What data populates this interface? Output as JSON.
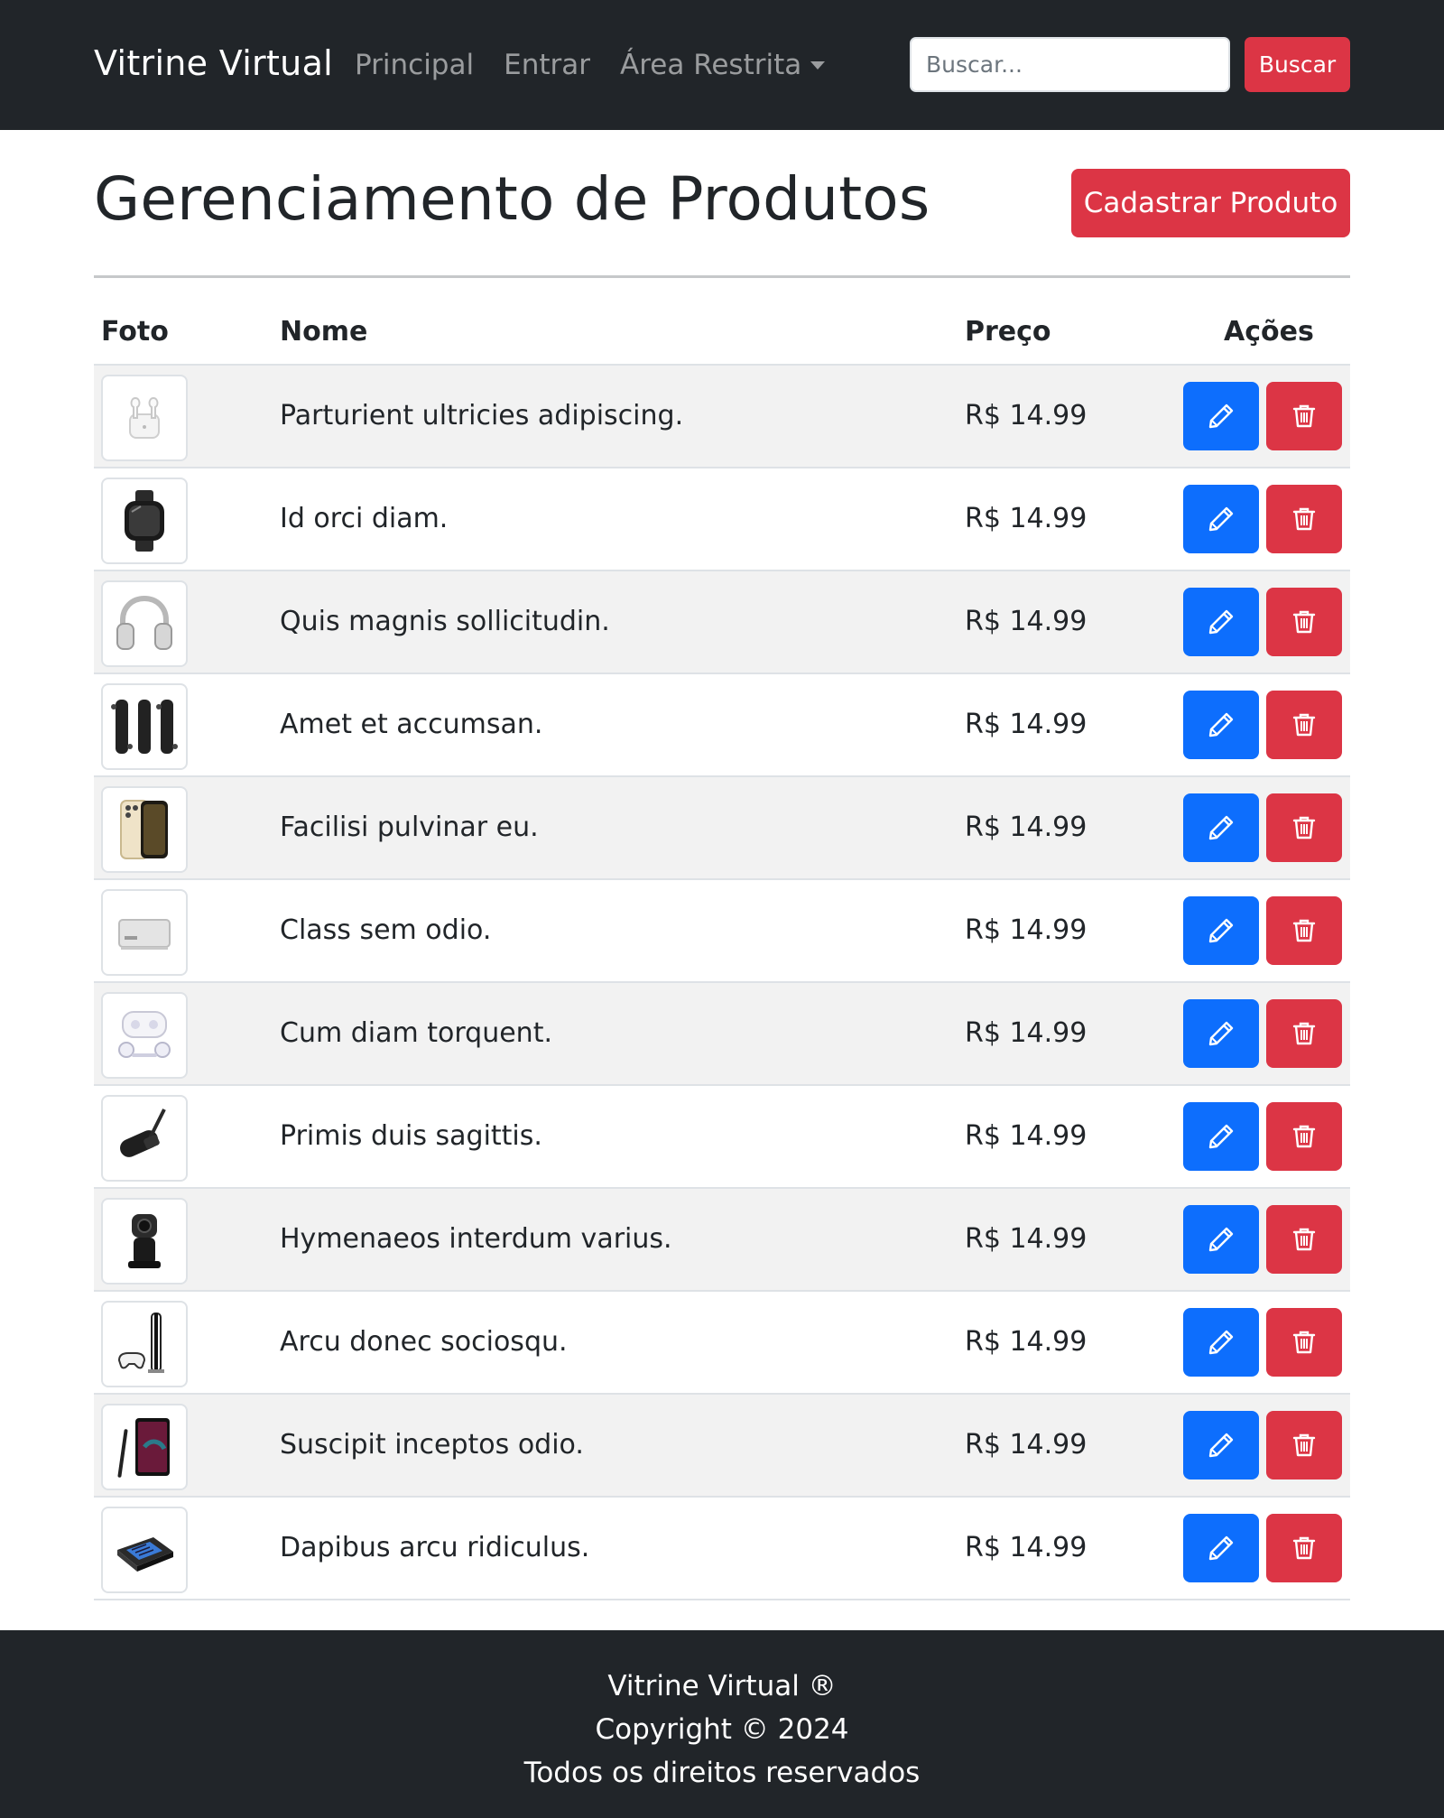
{
  "navbar": {
    "brand": "Vitrine Virtual",
    "links": [
      "Principal",
      "Entrar"
    ],
    "dropdown_label": "Área Restrita",
    "search_placeholder": "Buscar...",
    "search_button": "Buscar"
  },
  "page": {
    "title": "Gerenciamento de Produtos",
    "add_button": "Cadastrar Produto"
  },
  "table": {
    "headers": {
      "foto": "Foto",
      "nome": "Nome",
      "preco": "Preço",
      "acoes": "Ações"
    },
    "rows": [
      {
        "photo_icon": "earbuds-icon",
        "name": "Parturient ultricies adipiscing.",
        "price": "R$ 14.99"
      },
      {
        "photo_icon": "smartwatch-icon",
        "name": "Id orci diam.",
        "price": "R$ 14.99"
      },
      {
        "photo_icon": "headphones-icon",
        "name": "Quis magnis sollicitudin.",
        "price": "R$ 14.99"
      },
      {
        "photo_icon": "skateboard-icon",
        "name": "Amet et accumsan.",
        "price": "R$ 14.99"
      },
      {
        "photo_icon": "smartphone-icon",
        "name": "Facilisi pulvinar eu.",
        "price": "R$ 14.99"
      },
      {
        "photo_icon": "desktop-computer-icon",
        "name": "Class sem odio.",
        "price": "R$ 14.99"
      },
      {
        "photo_icon": "vr-headset-icon",
        "name": "Cum diam torquent.",
        "price": "R$ 14.99"
      },
      {
        "photo_icon": "microphone-icon",
        "name": "Primis duis sagittis.",
        "price": "R$ 14.99"
      },
      {
        "photo_icon": "webcam-icon",
        "name": "Hymenaeos interdum varius.",
        "price": "R$ 14.99"
      },
      {
        "photo_icon": "game-console-icon",
        "name": "Arcu donec sociosqu.",
        "price": "R$ 14.99"
      },
      {
        "photo_icon": "phone-stylus-icon",
        "name": "Suscipit inceptos odio.",
        "price": "R$ 14.99"
      },
      {
        "photo_icon": "stream-deck-icon",
        "name": "Dapibus arcu ridiculus.",
        "price": "R$ 14.99"
      }
    ],
    "edit_icon": "pencil-icon",
    "delete_icon": "trash-icon"
  },
  "footer": {
    "line1": "Vitrine Virtual ®",
    "line2": "Copyright © 2024",
    "line3": "Todos os direitos reservados"
  },
  "colors": {
    "navbar_bg": "#212529",
    "danger": "#dc3545",
    "primary": "#0d6efd",
    "stripe": "#f2f2f2"
  }
}
